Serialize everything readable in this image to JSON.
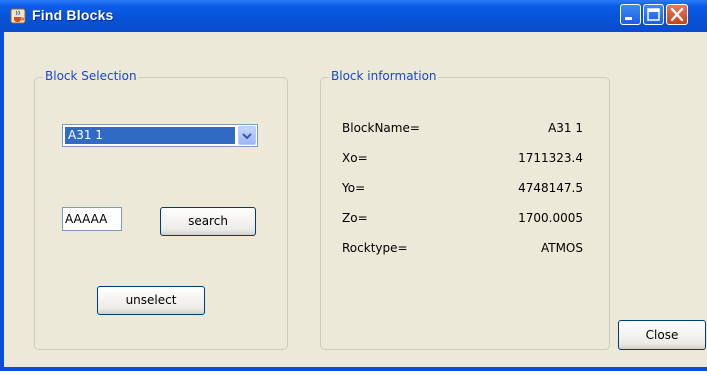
{
  "window": {
    "title": "Find Blocks"
  },
  "block_selection": {
    "legend": "Block Selection",
    "combo_value": "A31 1",
    "search_text": "AAAAA",
    "search_label": "search",
    "unselect_label": "unselect"
  },
  "block_info": {
    "legend": "Block information",
    "rows": [
      {
        "label": "BlockName=",
        "value": "A31 1"
      },
      {
        "label": "Xo=",
        "value": "1711323.4"
      },
      {
        "label": "Yo=",
        "value": "4748147.5"
      },
      {
        "label": "Zo=",
        "value": "1700.0005"
      },
      {
        "label": "Rocktype=",
        "value": "ATMOS"
      }
    ]
  },
  "footer": {
    "close_label": "Close"
  },
  "colors": {
    "title_bar": "#0a5ce8",
    "client_bg": "#ece9d8",
    "legend": "#1a46d1",
    "selection": "#316ac5"
  },
  "icons": [
    "java-cup-icon",
    "minimize-icon",
    "maximize-icon",
    "close-icon",
    "chevron-down-icon"
  ]
}
